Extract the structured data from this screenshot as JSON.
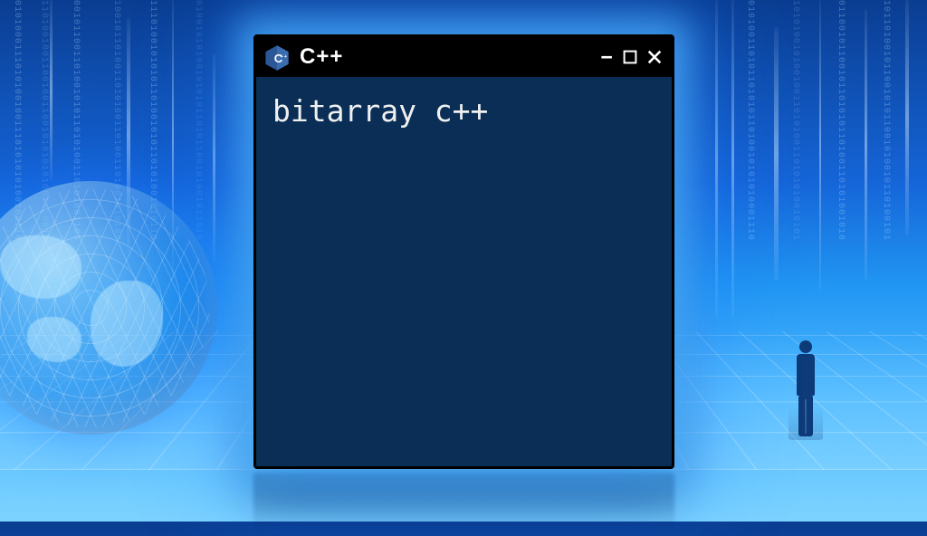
{
  "window": {
    "title": "C++",
    "icon_name": "cpp-hexagon-icon"
  },
  "terminal": {
    "content": "bitarray c++"
  },
  "controls": {
    "minimize_symbol": "–",
    "maximize_label": "maximize",
    "close_label": "close"
  }
}
